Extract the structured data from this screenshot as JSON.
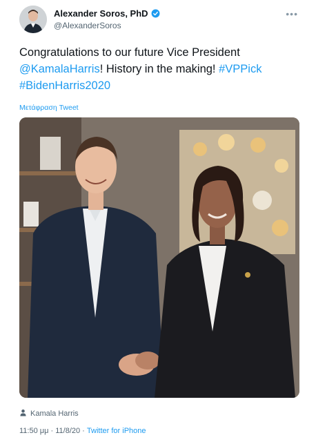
{
  "author": {
    "display_name": "Alexander Soros, PhD",
    "handle": "@AlexanderSoros",
    "verified": true
  },
  "more_icon": "ellipsis-icon",
  "tweet": {
    "text_plain_1": "Congratulations to our future Vice President",
    "mention": "@KamalaHarris",
    "text_plain_2": "! History in the making! ",
    "hashtag_1": "#VPPick",
    "hashtag_2": "#BidenHarris2020"
  },
  "translate_label": "Μετάφραση Tweet",
  "photo": {
    "alt": "photo-two-people-shaking-hands"
  },
  "tagged": {
    "icon": "person-icon",
    "name": "Kamala Harris"
  },
  "meta": {
    "time": "11:50 μμ",
    "separator": " · ",
    "date": "11/8/20",
    "source": "Twitter for iPhone"
  },
  "colors": {
    "link": "#1d9bf0",
    "text": "#0f1419",
    "secondary": "#536471"
  }
}
